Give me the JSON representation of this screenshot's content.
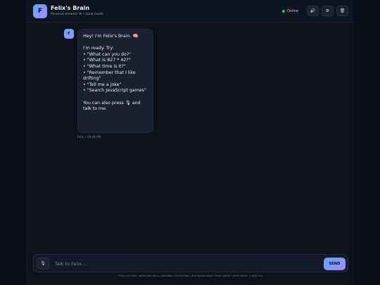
{
  "header": {
    "logo_letter": "F",
    "title": "Felix's Brain",
    "subtitle": "Personal browser AI • local mode",
    "status": "Online",
    "buttons": {
      "speaker_icon": "🔊",
      "settings_icon": "⚙",
      "trash_icon": "🗑"
    }
  },
  "chat": {
    "messages": [
      {
        "avatar": "F",
        "lines": [
          "Hey! I'm Felix's Brain. 🧠",
          "",
          "I'm ready. Try:",
          "• \"What can you do?\"",
          "• \"What is 827 * 42?\"",
          "• \"What time is it?\"",
          "• \"Remember that I like",
          "drifting\"",
          "• \"Tell me a joke\"",
          "• \"Search JavaScript games\"",
          "",
          "You can also press 🎙 and",
          "talk to me."
        ],
        "meta": "Felix • 09:49 AM"
      }
    ]
  },
  "composer": {
    "mic_icon": "🎙",
    "placeholder": "Talk to Felix...",
    "value": "",
    "send_label": "SEND"
  },
  "footer": "Felix can chat, remember facts, calculate, tell the time, and speak aloud. Enter sends • Shift+Enter = new line",
  "colors": {
    "accent_start": "#60a5fa",
    "accent_end": "#a78bfa",
    "online": "#22c55e"
  }
}
